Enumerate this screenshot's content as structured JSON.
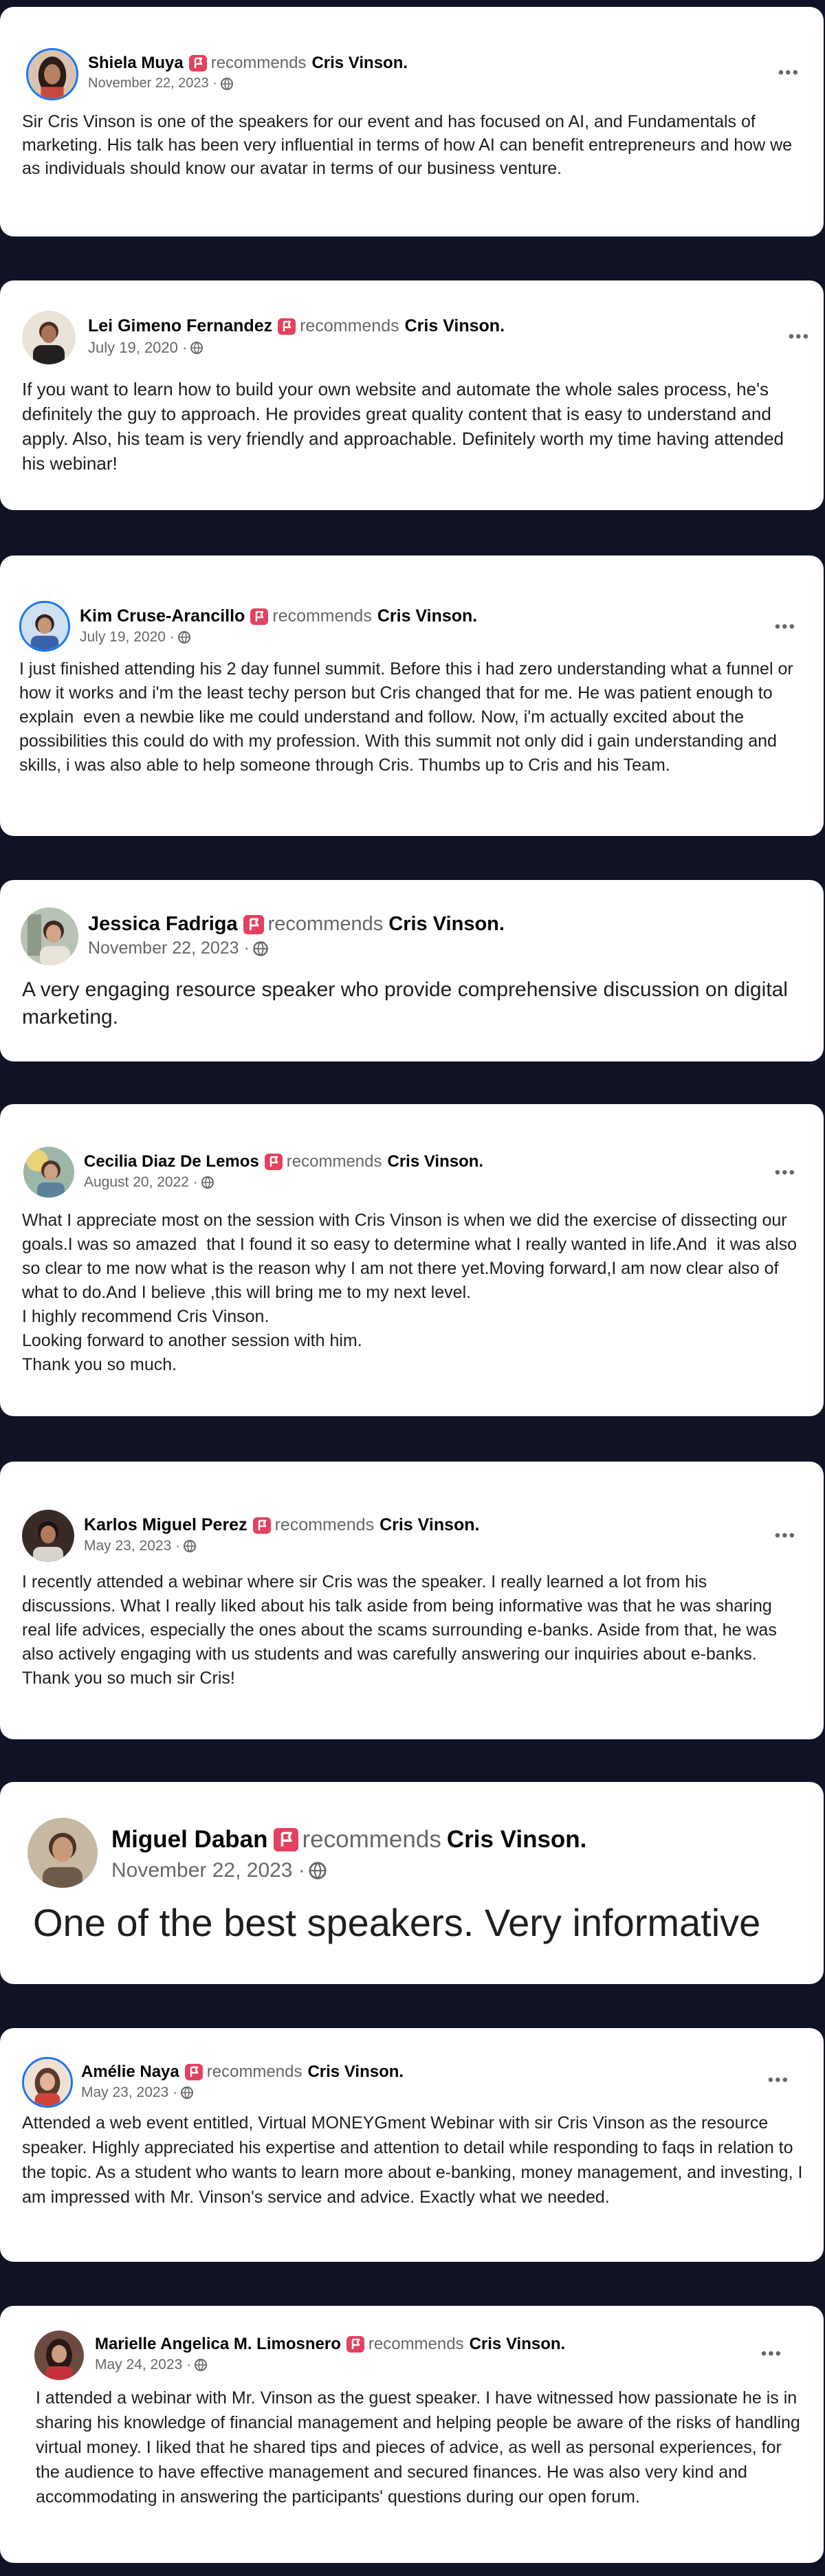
{
  "recommends_label": "recommends",
  "recommended_name": "Cris Vinson.",
  "more_label": "•••",
  "reviews": [
    {
      "author": "Shiela Muya",
      "date": "November 22, 2023 ·",
      "text": "Sir Cris Vinson is one of the speakers for our event and has focused on AI, and Fundamentals of marketing. His talk has been very influential in terms of how AI can benefit entrepreneurs and how we as individuals should know our avatar in terms of our business venture."
    },
    {
      "author": "Lei Gimeno Fernandez",
      "date": "July 19, 2020 ·",
      "text": "If you want to learn how to build your own website and automate the whole sales process, he's definitely the guy to approach. He provides great quality content that is easy to understand and apply. Also, his team is very friendly and approachable. Definitely worth my time having attended his webinar!"
    },
    {
      "author": "Kim Cruse-Arancillo",
      "date": "July 19, 2020 ·",
      "text": "I just finished attending his 2 day funnel summit. Before this i had zero understanding what a funnel or how it works and i'm the least techy person but Cris changed that for me. He was patient enough to explain  even a newbie like me could understand and follow. Now, i'm actually excited about the possibilities this could do with my profession. With this summit not only did i gain understanding and skills, i was also able to help someone through Cris. Thumbs up to Cris and his Team."
    },
    {
      "author": "Jessica Fadriga",
      "date": "November 22, 2023 ·",
      "text": "A very engaging resource speaker who provide comprehensive discussion on digital marketing."
    },
    {
      "author": "Cecilia Diaz De Lemos",
      "date": "August 20, 2022 ·",
      "text": "What I appreciate most on the session with Cris Vinson is when we did the exercise of dissecting our goals.I was so amazed  that I found it so easy to determine what I really wanted in life.And  it was also so clear to me now what is the reason why I am not there yet.Moving forward,I am now clear also of what to do.And I believe ,this will bring me to my next level.\nI highly recommend Cris Vinson.\nLooking forward to another session with him.\nThank you so much."
    },
    {
      "author": "Karlos Miguel Perez",
      "date": "May 23, 2023 ·",
      "text": "I recently attended a webinar where sir Cris was the speaker. I really learned a lot from his discussions. What I really liked about his talk aside from being informative was that he was sharing real life advices, especially the ones about the scams surrounding e-banks. Aside from that, he was also actively engaging with us students and was carefully answering our inquiries about e-banks. Thank you so much sir Cris!"
    },
    {
      "author": "Miguel Daban",
      "date": "November 22, 2023 ·",
      "text": "One of the best speakers. Very informative"
    },
    {
      "author": "Amélie Naya",
      "date": "May 23, 2023 ·",
      "text": "Attended a web event entitled, Virtual MONEYGment Webinar with sir Cris Vinson as the resource speaker. Highly appreciated his expertise and attention to detail while responding to faqs in relation to the topic. As a student who wants to learn more about e-banking, money management, and investing, I am impressed with Mr. Vinson's service and advice. Exactly what we needed."
    },
    {
      "author": "Marielle Angelica M. Limosnero",
      "date": "May 24, 2023 ·",
      "text": "I attended a webinar with Mr. Vinson as the guest speaker. I have witnessed how passionate he is in sharing his knowledge of financial management and helping people be aware of the risks of handling virtual money. I liked that he shared tips and pieces of advice, as well as personal experiences, for the audience to have effective management and secured finances. He was also very kind and accommodating in answering the participants' questions during our open forum."
    }
  ],
  "colors": {
    "page_background": "#101326",
    "card_background": "#ffffff",
    "recommend_badge": "#e4405f",
    "secondary_text": "#65676b",
    "avatar_ring": "#1877f2"
  }
}
